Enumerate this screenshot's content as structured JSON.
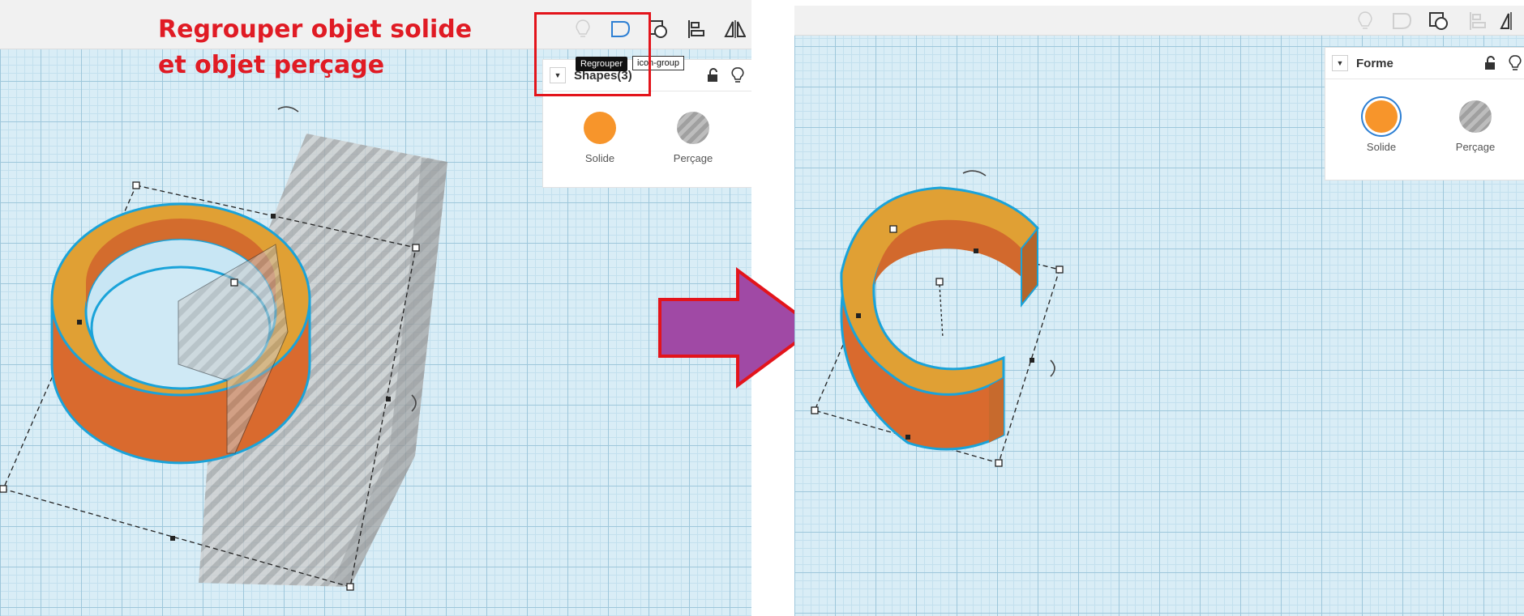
{
  "annotation": {
    "line1": "Regrouper objet solide",
    "line2": "et objet perçage"
  },
  "left": {
    "panel": {
      "title": "Shapes(3)",
      "solid_label": "Solide",
      "hole_label": "Perçage"
    },
    "tooltip": {
      "primary": "Regrouper",
      "secondary": "icon-group"
    }
  },
  "right": {
    "panel": {
      "title": "Forme",
      "solid_label": "Solide",
      "hole_label": "Perçage"
    }
  },
  "colors": {
    "solid": "#f7952b",
    "highlight": "#e3141b",
    "arrow": "#a049a5"
  },
  "icons": [
    "light-bulb-icon",
    "group-icon",
    "ungroup-icon",
    "align-icon",
    "mirror-icon",
    "lock-icon",
    "caret-down-icon"
  ]
}
